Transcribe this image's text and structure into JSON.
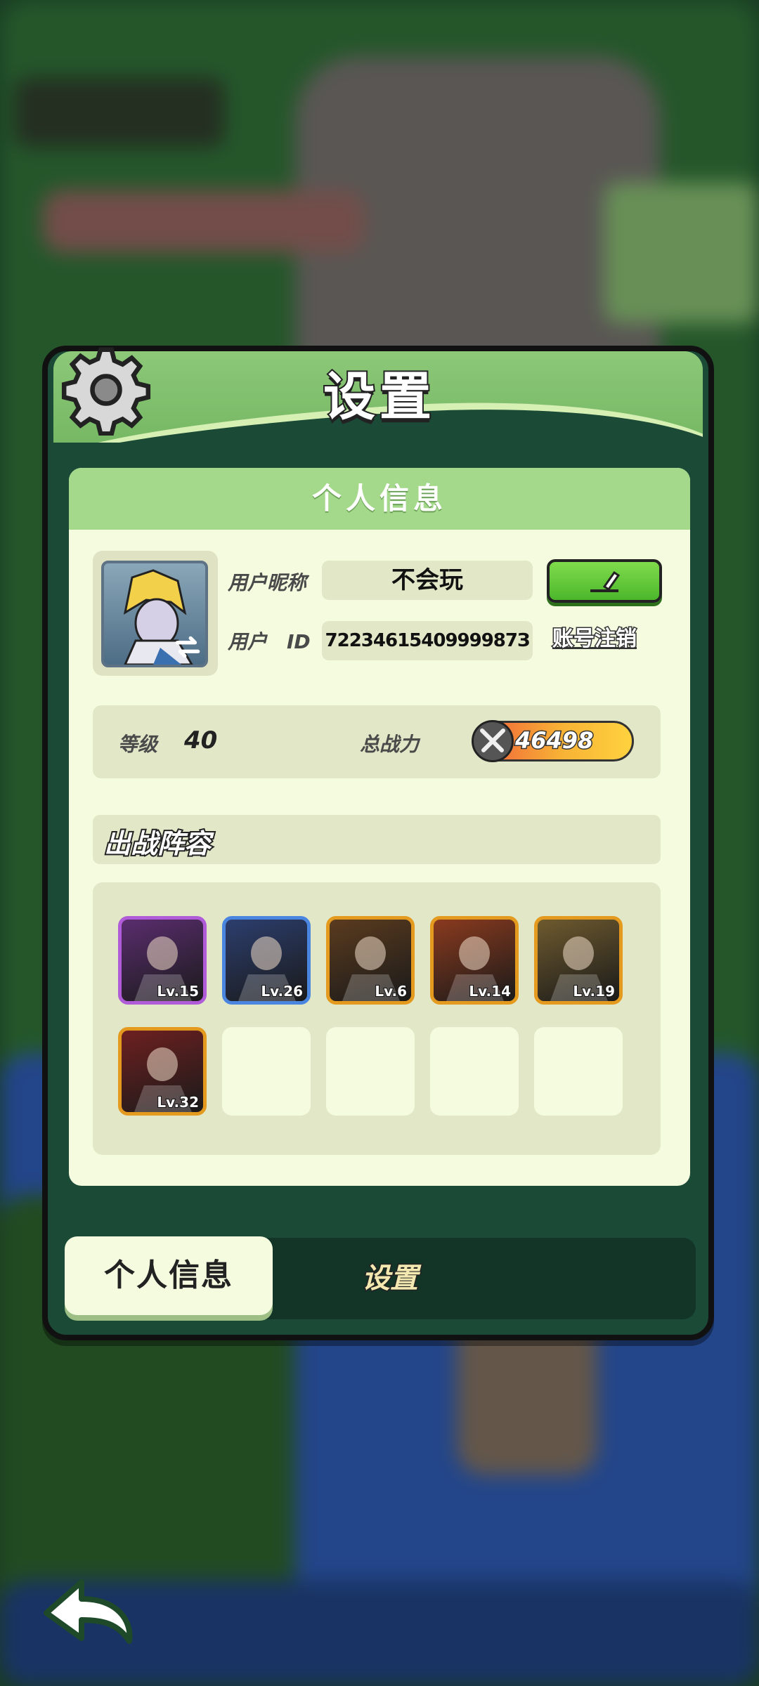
{
  "header": {
    "title": "设置",
    "settings_icon": "gear-icon"
  },
  "card": {
    "heading": "个人信息",
    "profile": {
      "nickname_label": "用户昵称",
      "nickname": "不会玩",
      "id_label": "用户　ID",
      "user_id": "7223461540999987З",
      "edit_icon": "pencil-icon",
      "cancel_account_link": "账号注销"
    },
    "stats": {
      "level_label": "等级",
      "level": "40",
      "power_label": "总战力",
      "power": "46498"
    },
    "lineup": {
      "title": "出战阵容",
      "heroes": [
        {
          "level": "Lv.15",
          "frame": "#b05cd8",
          "art": "#5a2d6e"
        },
        {
          "level": "Lv.26",
          "frame": "#4a86e0",
          "art": "#2c3e6e"
        },
        {
          "level": "Lv.6",
          "frame": "#e39a1f",
          "art": "#5a3b1e"
        },
        {
          "level": "Lv.14",
          "frame": "#e39a1f",
          "art": "#8a3a1e"
        },
        {
          "level": "Lv.19",
          "frame": "#e39a1f",
          "art": "#6e5a2e"
        },
        {
          "level": "Lv.32",
          "frame": "#e39a1f",
          "art": "#6e2020"
        }
      ],
      "empty_slots": 4
    }
  },
  "tabs": [
    {
      "label": "个人信息",
      "active": true
    },
    {
      "label": "设置",
      "active": false
    }
  ],
  "colors": {
    "header_green": "#8cc878",
    "card_bg": "#f5fbdf",
    "edit_button": "#5cc934",
    "panel_dark": "#1b4a36"
  },
  "back_icon": "back-arrow-icon"
}
